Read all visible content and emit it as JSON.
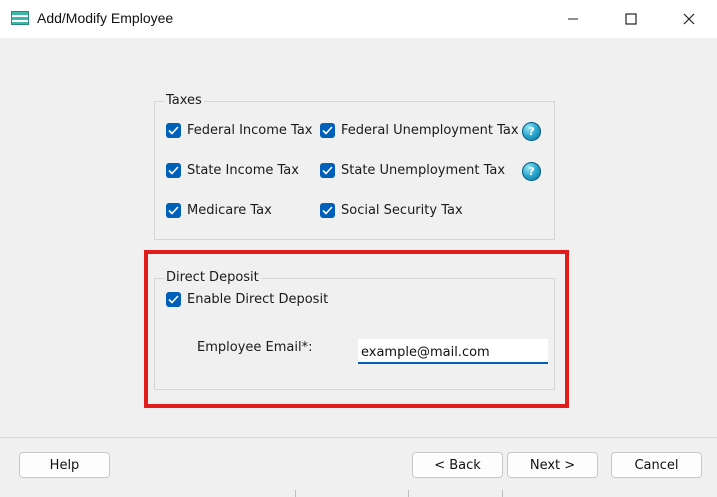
{
  "window": {
    "title": "Add/Modify Employee",
    "icon": "employee-app-icon",
    "controls": [
      "minimize",
      "maximize",
      "close"
    ]
  },
  "taxes": {
    "label": "Taxes",
    "items": [
      {
        "label": "Federal Income Tax",
        "checked": true
      },
      {
        "label": "Federal Unemployment Tax",
        "checked": true,
        "help_icon": true
      },
      {
        "label": "State Income Tax",
        "checked": true
      },
      {
        "label": "State Unemployment Tax",
        "checked": true,
        "help_icon": true
      },
      {
        "label": "Medicare Tax",
        "checked": true
      },
      {
        "label": "Social Security Tax",
        "checked": true
      }
    ]
  },
  "direct_deposit": {
    "label": "Direct Deposit",
    "enable_label": "Enable Direct Deposit",
    "enable_checked": true,
    "email_label": "Employee Email*:",
    "email_value": "example@mail.com"
  },
  "buttons": {
    "help": "Help",
    "back": "< Back",
    "next": "Next >",
    "cancel": "Cancel"
  },
  "colors": {
    "accent": "#005fb8",
    "highlight": "#e21b1b",
    "background": "#f0f0f0"
  }
}
